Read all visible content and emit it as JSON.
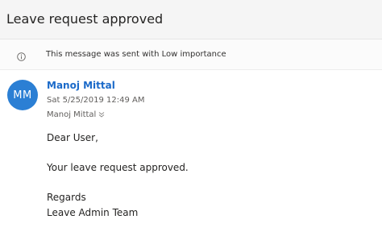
{
  "email": {
    "subject": "Leave request approved",
    "importance_notice": "This message was sent with Low importance",
    "sender": {
      "initials": "MM",
      "name": "Manoj Mittal",
      "avatar_color": "#2b7fd4"
    },
    "date": "Sat 5/25/2019 12:49 AM",
    "to": "Manoj Mittal",
    "body": {
      "greeting": "Dear User,",
      "message": "Your leave request approved.",
      "closing": "Regards",
      "signature": "Leave Admin Team"
    }
  },
  "icons": {
    "info": "info-icon",
    "expand_recipients": "chevron-down-icon"
  },
  "colors": {
    "sender_link": "#1b6ac9",
    "subject_bar": "#f5f5f5"
  }
}
